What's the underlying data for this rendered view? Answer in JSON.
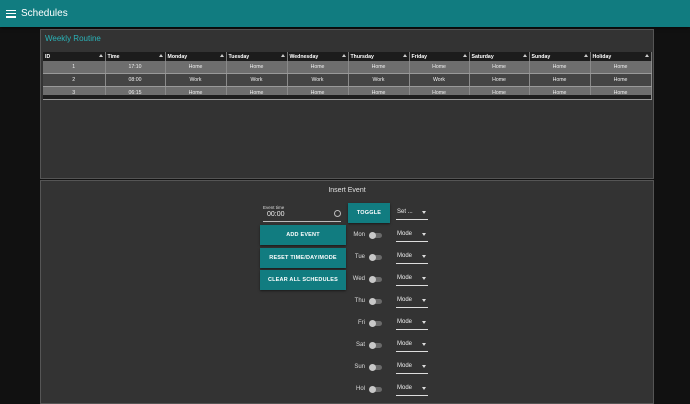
{
  "header": {
    "title": "Schedules",
    "menu_icon": "hamburger-menu-icon",
    "bar_color": "#117c80"
  },
  "routine": {
    "title": "Weekly Routine",
    "columns": [
      "ID",
      "Time",
      "Monday",
      "Tuesday",
      "Wednesday",
      "Thursday",
      "Friday",
      "Saturday",
      "Sunday",
      "Holiday"
    ],
    "rows": [
      [
        "1",
        "17:10",
        "Home",
        "Home",
        "Home",
        "Home",
        "Home",
        "Home",
        "Home",
        "Home"
      ],
      [
        "2",
        "08:00",
        "Work",
        "Work",
        "Work",
        "Work",
        "Work",
        "Home",
        "Home",
        "Home"
      ],
      [
        "3",
        "06:15",
        "Home",
        "Home",
        "Home",
        "Home",
        "Home",
        "Home",
        "Home",
        "Home"
      ]
    ]
  },
  "insert": {
    "title": "Insert Event",
    "event_time_label": "Event time",
    "event_time_value": "00:00",
    "toggle_label": "TOGGLE",
    "set_value": "Set ...",
    "buttons": {
      "add": "ADD EVENT",
      "reset": "RESET TIME/DAY/MODE",
      "clear": "CLEAR ALL SCHEDULES"
    },
    "days": [
      {
        "label": "Mon",
        "mode": "Mode"
      },
      {
        "label": "Tue",
        "mode": "Mode"
      },
      {
        "label": "Wed",
        "mode": "Mode"
      },
      {
        "label": "Thu",
        "mode": "Mode"
      },
      {
        "label": "Fri",
        "mode": "Mode"
      },
      {
        "label": "Sat",
        "mode": "Mode"
      },
      {
        "label": "Sun",
        "mode": "Mode"
      },
      {
        "label": "Hol",
        "mode": "Mode"
      }
    ]
  }
}
